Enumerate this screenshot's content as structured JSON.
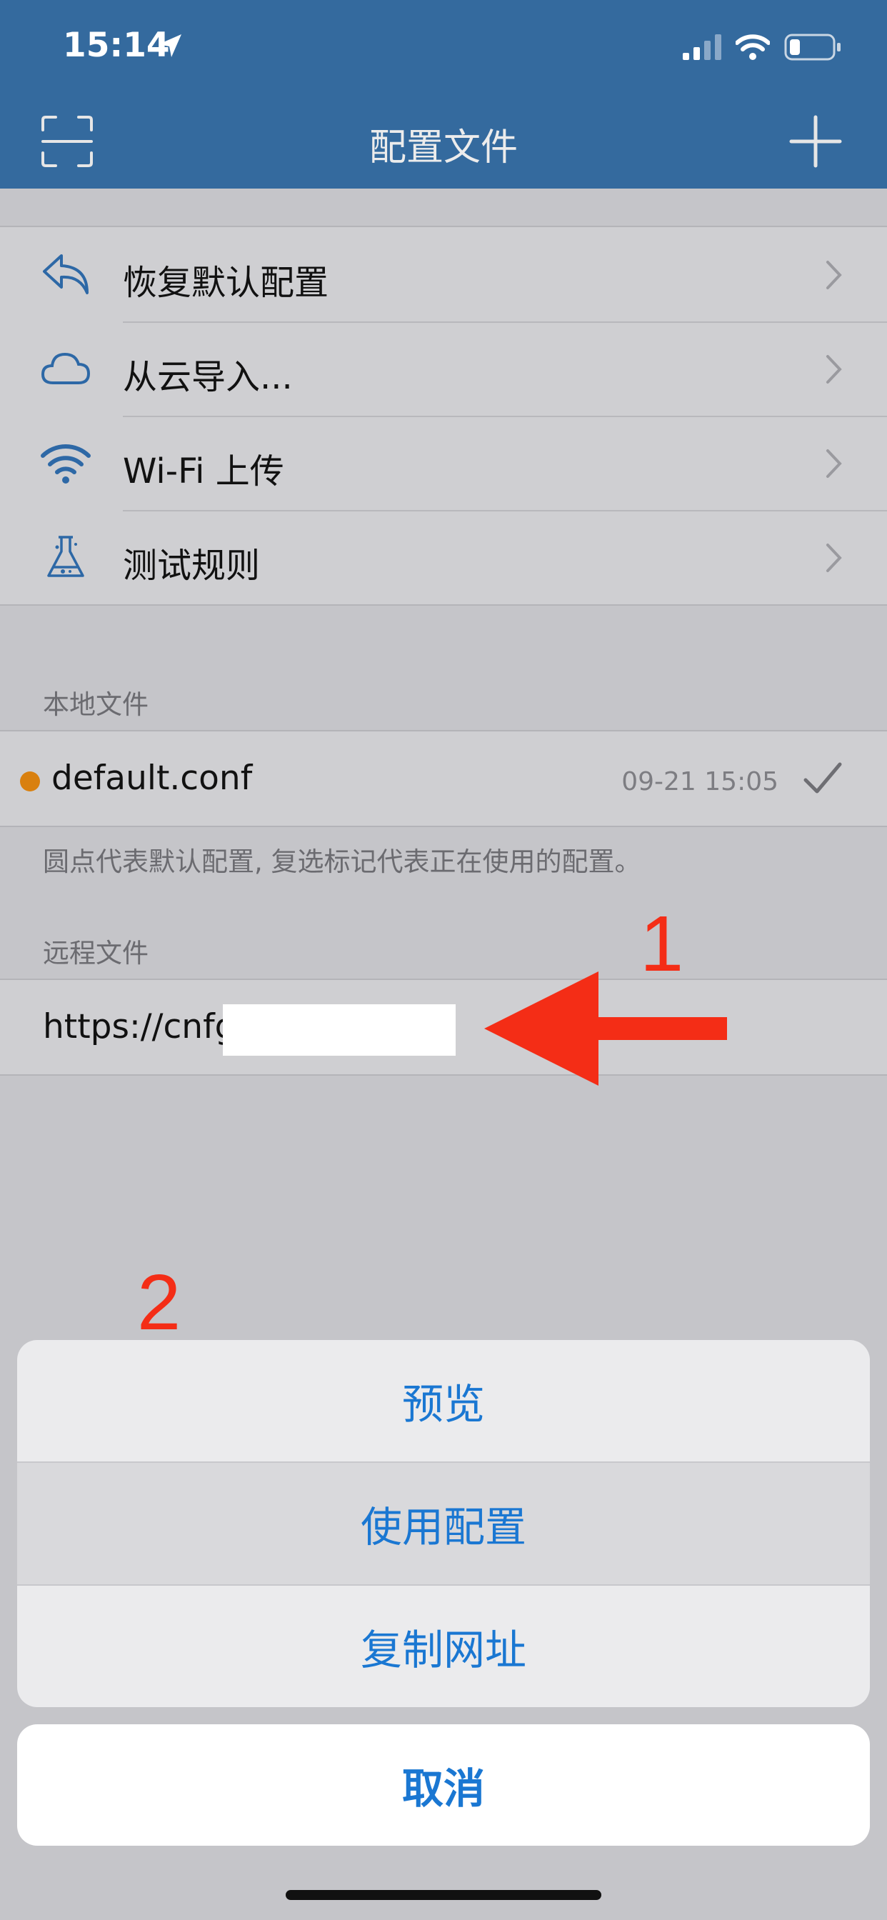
{
  "status_bar": {
    "time": "15:14"
  },
  "navbar": {
    "title": "配置文件",
    "left_icon": "scan-icon",
    "right_icon": "plus-icon"
  },
  "menu": [
    {
      "label": "恢复默认配置",
      "icon": "undo-arrow-icon"
    },
    {
      "label": "从云导入...",
      "icon": "cloud-icon"
    },
    {
      "label": "Wi-Fi 上传",
      "icon": "wifi-icon"
    },
    {
      "label": "测试规则",
      "icon": "flask-icon"
    }
  ],
  "local_section": {
    "header": "本地文件",
    "file": {
      "name": "default.conf",
      "time": "09-21 15:05",
      "is_default": true,
      "in_use": true
    },
    "footnote": "圆点代表默认配置, 复选标记代表正在使用的配置。"
  },
  "remote_section": {
    "header": "远程文件",
    "url": "https://cnfg"
  },
  "annotations": {
    "step1": "1",
    "step2": "2",
    "arrow_color": "#f42d16"
  },
  "action_sheet": {
    "options": [
      "预览",
      "使用配置",
      "复制网址"
    ],
    "highlighted_index": 1,
    "cancel": "取消"
  },
  "colors": {
    "nav_bg": "#346a9e",
    "accent": "#1a77d2",
    "default_dot": "#d9800f"
  }
}
